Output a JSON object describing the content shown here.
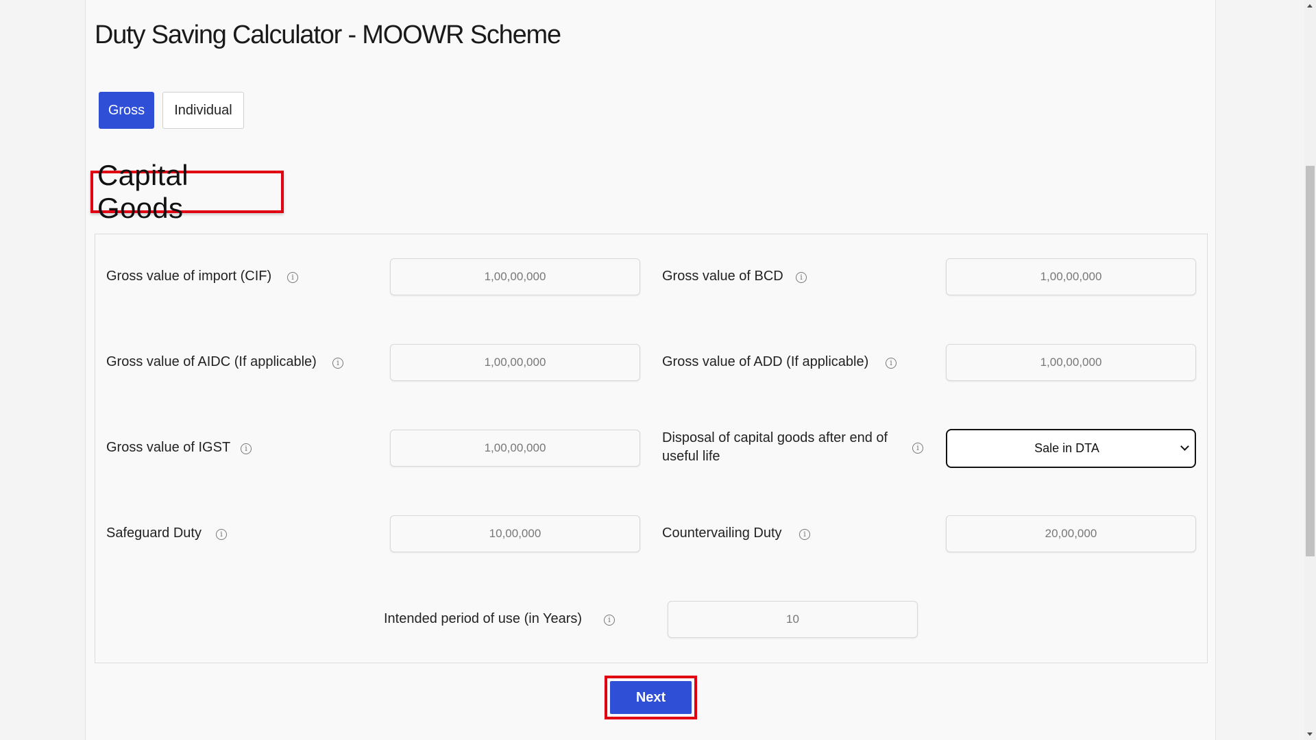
{
  "page_title": "Duty Saving Calculator - MOOWR Scheme",
  "tabs": {
    "gross": "Gross",
    "individual": "Individual"
  },
  "section_title": "Capital Goods",
  "fields": {
    "cif": {
      "label": "Gross value of import (CIF)",
      "placeholder": "1,00,00,000"
    },
    "bcd": {
      "label": "Gross value of BCD",
      "placeholder": "1,00,00,000"
    },
    "aidc": {
      "label": "Gross value of AIDC (If applicable)",
      "placeholder": "1,00,00,000"
    },
    "add": {
      "label": "Gross value of ADD (If applicable)",
      "placeholder": "1,00,00,000"
    },
    "igst": {
      "label": "Gross value of IGST",
      "placeholder": "1,00,00,000"
    },
    "disposal": {
      "label": "Disposal of capital goods after end of useful life",
      "selected": "Sale in DTA"
    },
    "safeguard": {
      "label": "Safeguard Duty",
      "placeholder": "10,00,000"
    },
    "countervailing": {
      "label": "Countervailing Duty",
      "placeholder": "20,00,000"
    },
    "period": {
      "label": "Intended period of use (in Years)",
      "placeholder": "10"
    }
  },
  "info_icon_glyph": "i",
  "next_label": "Next",
  "colors": {
    "primary": "#2f4fd6",
    "highlight": "#e00012"
  }
}
